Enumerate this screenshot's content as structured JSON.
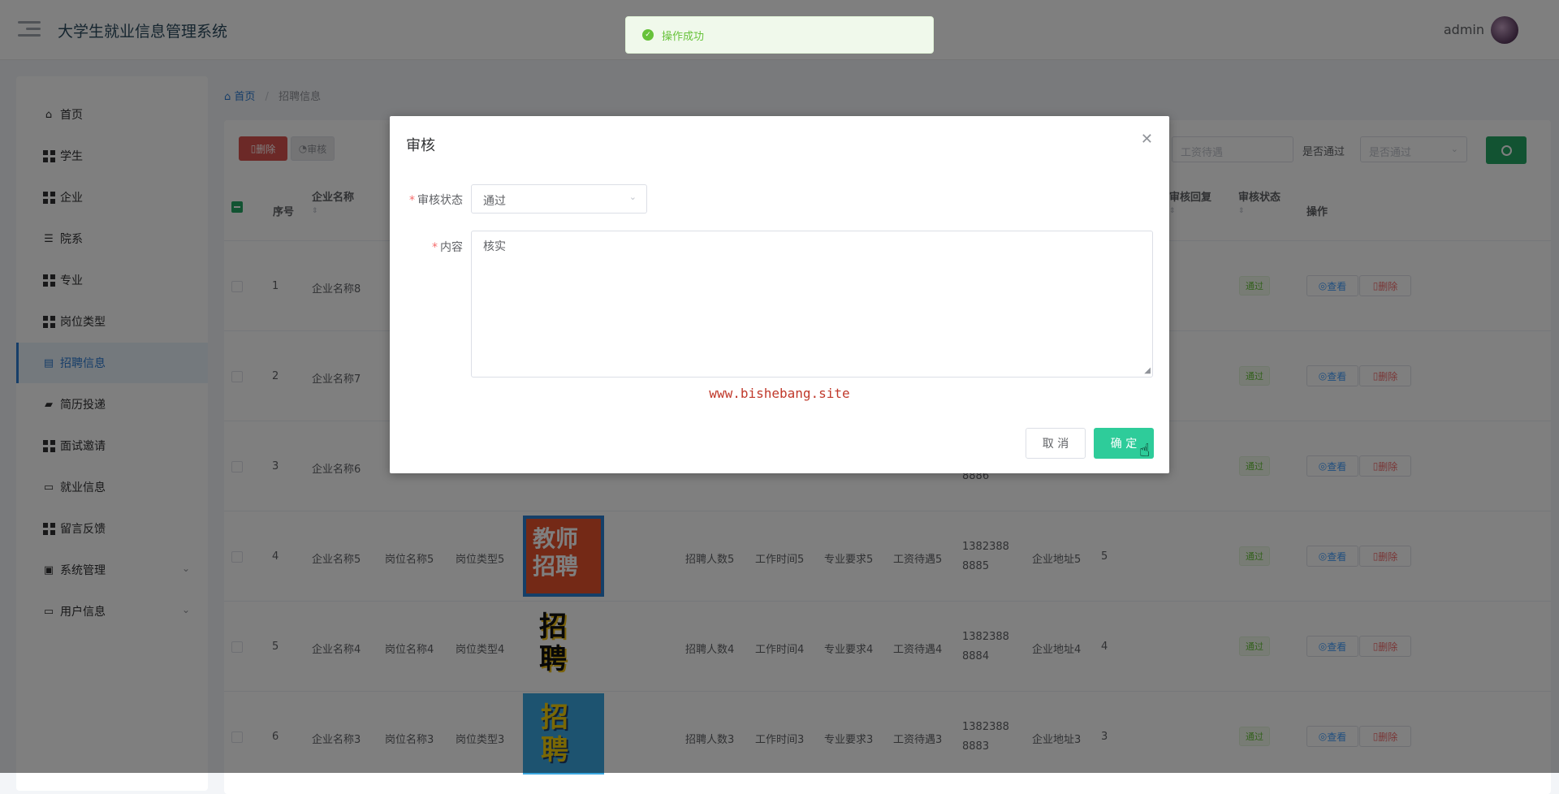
{
  "header": {
    "title": "大学生就业信息管理系统",
    "user": "admin"
  },
  "sidebar": {
    "items": [
      {
        "label": "首页",
        "icon": "home-icon"
      },
      {
        "label": "学生",
        "icon": "grid-icon"
      },
      {
        "label": "企业",
        "icon": "grid-icon"
      },
      {
        "label": "院系",
        "icon": "list-icon"
      },
      {
        "label": "专业",
        "icon": "grid-icon"
      },
      {
        "label": "岗位类型",
        "icon": "grid-icon"
      },
      {
        "label": "招聘信息",
        "icon": "chart-icon"
      },
      {
        "label": "简历投递",
        "icon": "chat-icon"
      },
      {
        "label": "面试邀请",
        "icon": "grid-icon"
      },
      {
        "label": "就业信息",
        "icon": "monitor-icon"
      },
      {
        "label": "留言反馈",
        "icon": "grid-icon"
      },
      {
        "label": "系统管理",
        "icon": "clipboard-icon"
      },
      {
        "label": "用户信息",
        "icon": "card-icon"
      }
    ]
  },
  "breadcrumb": {
    "home": "首页",
    "current": "招聘信息"
  },
  "toolbar": {
    "delete": "删除",
    "audit": "审核",
    "salary_placeholder": "工资待遇",
    "pass_label": "是否通过",
    "pass_placeholder": "是否通过"
  },
  "table": {
    "headers": {
      "index": "序号",
      "company": "企业名称",
      "reply": "审核回复",
      "status": "审核状态",
      "action": "操作"
    },
    "rows": [
      {
        "index": "1",
        "company": "企业名称8",
        "status": "通过"
      },
      {
        "index": "2",
        "company": "企业名称7",
        "status": "通过"
      },
      {
        "index": "3",
        "company": "企业名称6",
        "phone2": "8886",
        "status": "通过"
      },
      {
        "index": "4",
        "company": "企业名称5",
        "job": "岗位名称5",
        "type": "岗位类型5",
        "count": "招聘人数5",
        "time": "工作时间5",
        "req": "专业要求5",
        "salary": "工资待遇5",
        "phone1": "1382388",
        "phone2": "8885",
        "addr": "企业地址5",
        "num": "5",
        "status": "通过",
        "poster": "教师\n招聘"
      },
      {
        "index": "5",
        "company": "企业名称4",
        "job": "岗位名称4",
        "type": "岗位类型4",
        "count": "招聘人数4",
        "time": "工作时间4",
        "req": "专业要求4",
        "salary": "工资待遇4",
        "phone1": "1382388",
        "phone2": "8884",
        "addr": "企业地址4",
        "num": "4",
        "status": "通过",
        "poster": "招聘"
      },
      {
        "index": "6",
        "company": "企业名称3",
        "job": "岗位名称3",
        "type": "岗位类型3",
        "count": "招聘人数3",
        "time": "工作时间3",
        "req": "专业要求3",
        "salary": "工资待遇3",
        "phone1": "1382388",
        "phone2": "8883",
        "addr": "企业地址3",
        "num": "3",
        "status": "通过",
        "poster": "招聘"
      }
    ],
    "view": "查看",
    "del": "删除"
  },
  "dialog": {
    "title": "审核",
    "status_label": "审核状态",
    "status_value": "通过",
    "content_label": "内容",
    "content_value": "核实",
    "watermark": "www.bishebang.site",
    "cancel": "取 消",
    "ok": "确 定"
  },
  "toast": {
    "text": "操作成功"
  },
  "colors": {
    "accent": "#2f7dd3",
    "success": "#24a664",
    "danger": "#d9534f",
    "confirm": "#2ecc9a"
  }
}
